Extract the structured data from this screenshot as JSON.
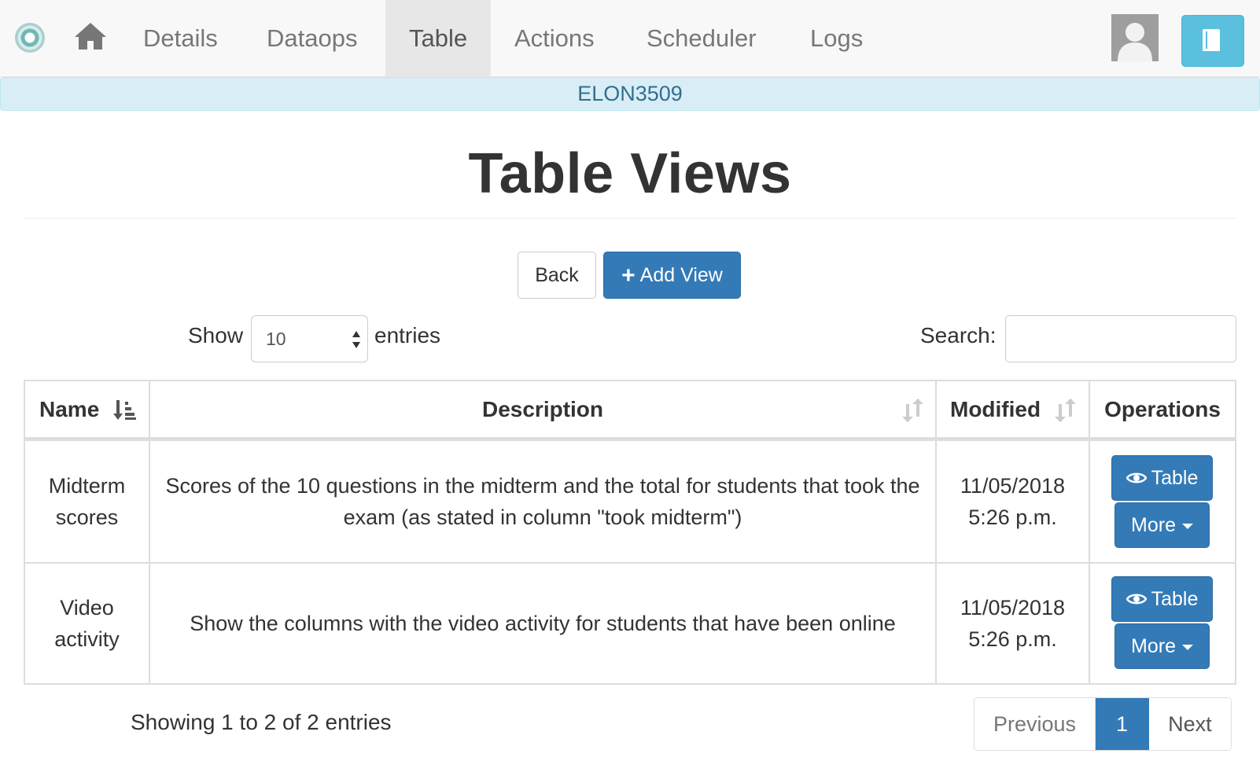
{
  "navbar": {
    "items": [
      {
        "label": "Details",
        "active": false
      },
      {
        "label": "Dataops",
        "active": false
      },
      {
        "label": "Table",
        "active": true
      },
      {
        "label": "Actions",
        "active": false
      },
      {
        "label": "Scheduler",
        "active": false
      },
      {
        "label": "Logs",
        "active": false
      }
    ],
    "icons": {
      "home": "home-icon",
      "logo": "brand-logo",
      "user": "user-avatar",
      "corner": "book-icon"
    },
    "accent_color": "#5bc0de"
  },
  "workflow": {
    "name": "ELON3509"
  },
  "page": {
    "title": "Table Views"
  },
  "actions": {
    "back_label": "Back",
    "add_label": "Add View",
    "add_icon": "plus-icon"
  },
  "length_control": {
    "show_label": "Show",
    "value": "10",
    "entries_label": "entries"
  },
  "search": {
    "label": "Search:",
    "value": ""
  },
  "table": {
    "headers": {
      "name": "Name",
      "description": "Description",
      "modified": "Modified",
      "operations": "Operations"
    },
    "rows": [
      {
        "name": "Midterm scores",
        "description": "Scores of the 10 questions in the midterm and the total for students that took the exam (as stated in column \"took midterm\")",
        "modified_date": "11/05/2018",
        "modified_time": "5:26 p.m.",
        "table_btn": "Table",
        "more_btn": "More"
      },
      {
        "name": "Video activity",
        "description": "Show the columns with the video activity for students that have been online",
        "modified_date": "11/05/2018",
        "modified_time": "5:26 p.m.",
        "table_btn": "Table",
        "more_btn": "More"
      }
    ]
  },
  "footer": {
    "info": "Showing 1 to 2 of 2 entries",
    "pagination": {
      "previous": "Previous",
      "current": "1",
      "next": "Next"
    }
  },
  "colors": {
    "primary": "#337ab7",
    "info_bg": "#d9edf7",
    "info_text": "#31708f"
  }
}
